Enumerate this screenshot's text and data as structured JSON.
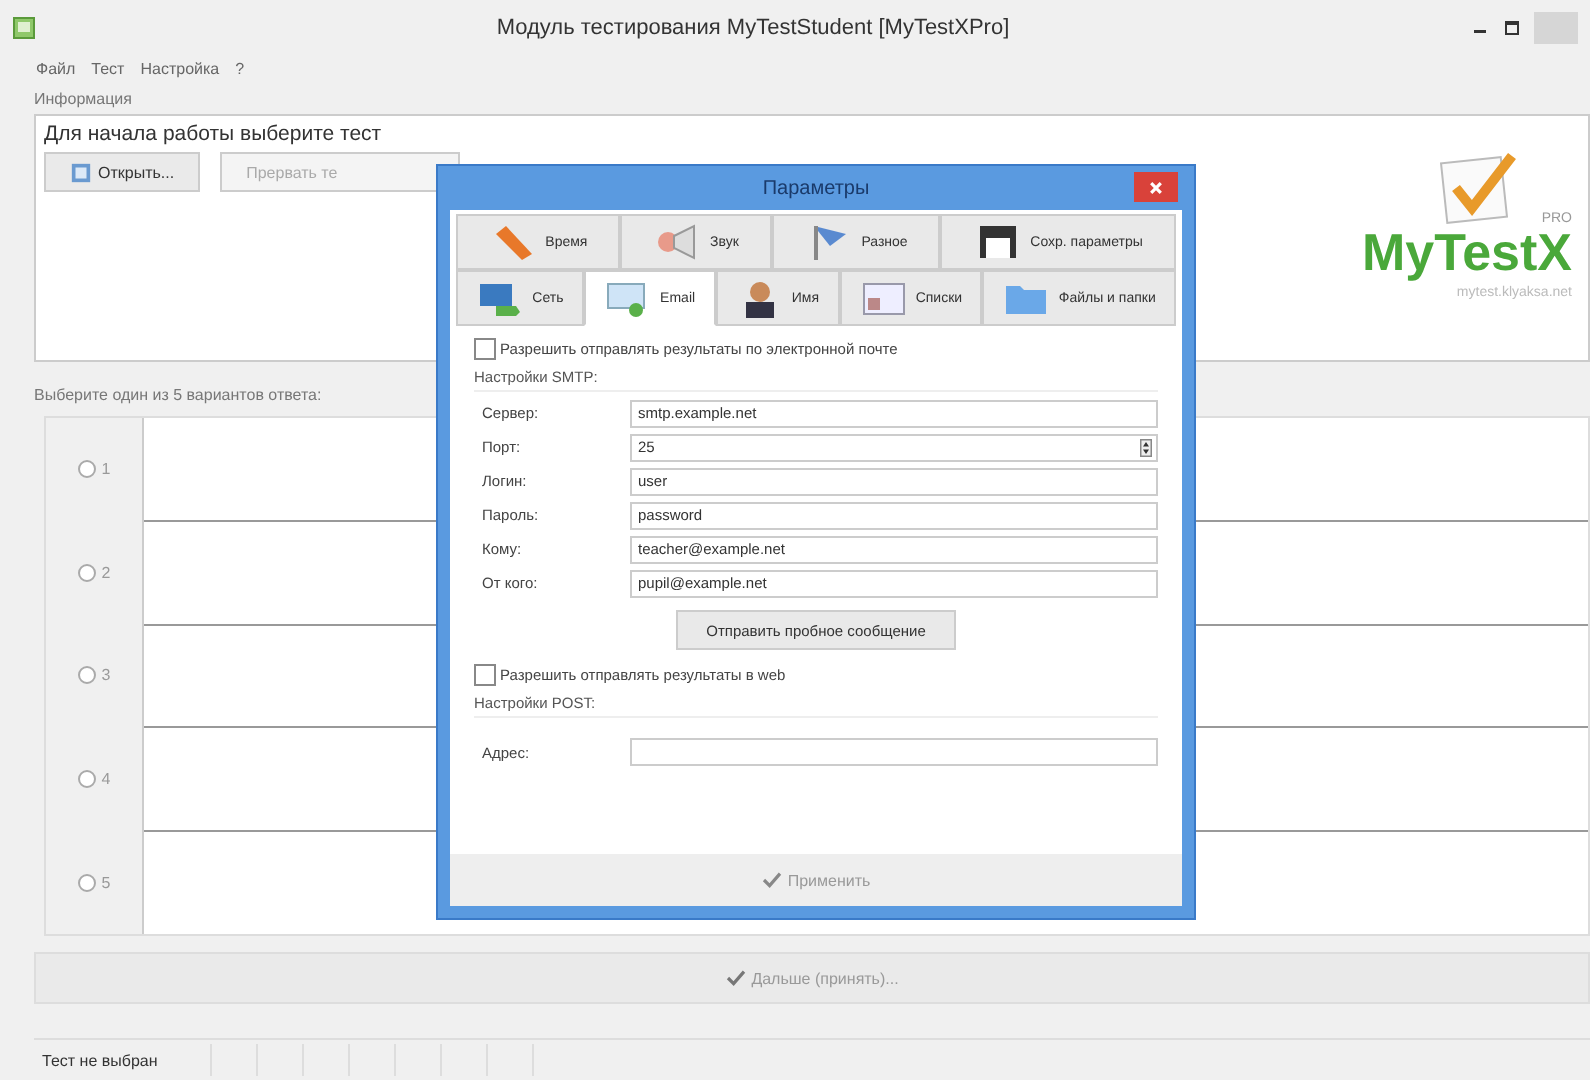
{
  "window": {
    "title": "Модуль тестирования MyTestStudent [MyTestXPro]"
  },
  "menu": [
    "Файл",
    "Тест",
    "Настройка",
    "?"
  ],
  "info": {
    "label": "Информация",
    "message": "Для начала работы выберите тест",
    "buttons": [
      {
        "label": "Открыть...",
        "disabled": false
      },
      {
        "label": "Прервать те",
        "disabled": true
      }
    ],
    "logo": {
      "pro": "PRO",
      "name": "MyTestX",
      "site": "mytest.klyaksa.net"
    }
  },
  "question": {
    "prompt": "Выберите один из 5 вариантов ответа:",
    "options": [
      {
        "label": "1",
        "selected": false
      },
      {
        "label": "2",
        "selected": false
      },
      {
        "label": "3",
        "selected": false
      },
      {
        "label": "4",
        "selected": false
      },
      {
        "label": "5",
        "selected": false
      }
    ]
  },
  "next_button": {
    "label": "Дальше (принять)...",
    "disabled": true
  },
  "status_bar": "Тест не выбран",
  "dialog": {
    "title": "Параметры",
    "tab_rows": [
      [
        {
          "label": "Время",
          "selected": false
        },
        {
          "label": "Звук",
          "selected": false
        },
        {
          "label": "Разное",
          "selected": false
        },
        {
          "label": "Сохр. параметры",
          "selected": false
        }
      ],
      [
        {
          "label": "Сеть",
          "selected": false
        },
        {
          "label": "Email",
          "selected": true
        },
        {
          "label": "Имя",
          "selected": false
        },
        {
          "label": "Списки",
          "selected": false
        },
        {
          "label": "Файлы и папки",
          "selected": false
        }
      ]
    ],
    "email_checkbox": {
      "label": "Разрешить отправлять результаты по электронной почте",
      "checked": false
    },
    "smtp_heading": "Настройки SMTP:",
    "smtp_fields": [
      {
        "label": "Сервер:",
        "value": "smtp.example.net",
        "kind": "text"
      },
      {
        "label": "Порт:",
        "value": "25",
        "kind": "spinner"
      },
      {
        "label": "Логин:",
        "value": "user",
        "kind": "text"
      },
      {
        "label": "Пароль:",
        "value": "password",
        "kind": "text"
      },
      {
        "label": "Кому:",
        "value": "teacher@example.net",
        "kind": "text"
      },
      {
        "label": "От кого:",
        "value": "pupil@example.net",
        "kind": "text"
      }
    ],
    "test_button": "Отправить пробное сообщение",
    "web_checkbox": {
      "label": "Разрешить отправлять результаты в web",
      "checked": false
    },
    "post_heading": "Настройки POST:",
    "post_fields": [
      {
        "label": "Адрес:",
        "kind": "text"
      }
    ],
    "apply_button": {
      "label": "Применить",
      "disabled": true
    }
  }
}
